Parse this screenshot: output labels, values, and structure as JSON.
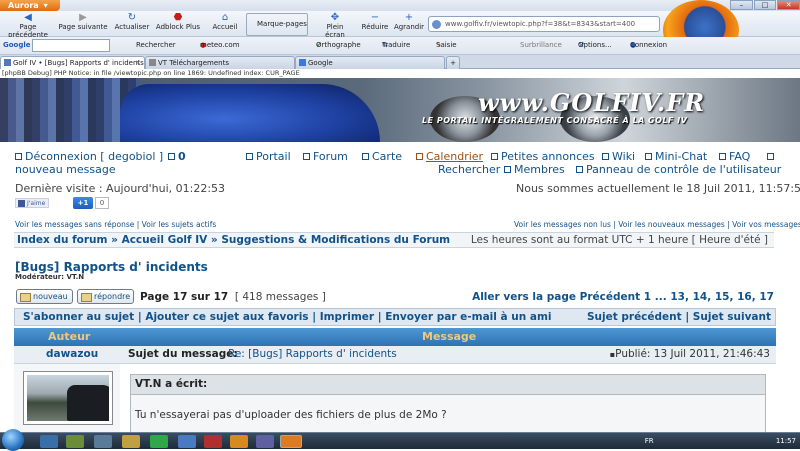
{
  "browser": {
    "app_menu": "Aurora",
    "nav_buttons": [
      "Page précédente",
      "Page suivante",
      "Actualiser",
      "Adblock Plus",
      "Accueil",
      "Marque-pages",
      "Plein écran",
      "Réduire",
      "Agrandir"
    ],
    "url": "www.golfiv.fr/viewtopic.php?f=38&t=8343&start=400",
    "toolbar": {
      "google": "Google",
      "search_btn": "Rechercher",
      "meteo": "meteo.com : Prévisions météo",
      "ortho": "Orthographe",
      "traduire": "Traduire",
      "saisie": "Saisie automatique",
      "surbrillance": "Surbrillance",
      "options": "Options...",
      "connexion": "Connexion"
    },
    "tabs": [
      {
        "label": "Golf IV • [Bugs] Rapports d' incidents ..."
      },
      {
        "label": "VT Téléchargements"
      },
      {
        "label": "Google"
      }
    ],
    "debug": "[phpBB Debug] PHP Notice: in file /viewtopic.php on line 1869: Undefined index: CUR_PAGE"
  },
  "banner": {
    "logo": "www.GOLFIV.FR",
    "slogan": "LE PORTAIL INTÉGRALEMENT CONSACRÉ À LA GOLF IV"
  },
  "header": {
    "logout": "Déconnexion [ degobiol ]",
    "pm_count": "0",
    "new_msg": "nouveau message",
    "nav": [
      "Portail",
      "Forum",
      "Carte",
      "Calendrier",
      "Petites annonces",
      "Wiki",
      "Mini-Chat",
      "FAQ"
    ],
    "nav2": [
      "Rechercher",
      "Membres",
      "Panneau de contrôle de l'utilisateur"
    ],
    "last_visit": "Dernière visite : Aujourd'hui, 01:22:53",
    "now": "Nous sommes actuellement le 18 Juil 2011, 11:57:50",
    "fb_like": "J'aime",
    "plus_one": "+1",
    "plus_count": "0",
    "links_left": "Voir les messages sans réponse | Voir les sujets actifs",
    "links_right": "Voir les messages non lus | Voir les nouveaux messages | Voir vos messages"
  },
  "breadcrumb": {
    "path": "Index du forum » Accueil Golf IV » Suggestions & Modifications du Forum",
    "timezone": "Les heures sont au format UTC + 1 heure [ Heure d'été ]"
  },
  "topic": {
    "title": "[Bugs] Rapports d' incidents",
    "moderator": "Modérateur: VT.N",
    "new_btn": "nouveau",
    "reply_btn": "répondre",
    "page_info": "Page 17 sur 17",
    "msg_count": "[ 418 messages ]",
    "goto": "Aller vers la page Précédent  1 ... 13, 14, 15, 16, 17",
    "actions_left": "S'abonner au sujet | Ajouter ce sujet aux favoris | Imprimer | Envoyer par e-mail à un ami",
    "actions_right": "Sujet précédent | Sujet suivant"
  },
  "table": {
    "col_author": "Auteur",
    "col_message": "Message"
  },
  "post": {
    "author": "dawazou",
    "subject_label": "Sujet du message:",
    "subject": "Re: [Bugs] Rapports d' incidents",
    "published": "Publié: 13 Juil 2011, 21:46:43",
    "quote_header": "VT.N a écrit:",
    "quote_text": "Tu n'essayerai pas d'uploader des fichiers de plus de 2Mo ?"
  },
  "taskbar": {
    "lang": "FR",
    "time": "11:57"
  }
}
